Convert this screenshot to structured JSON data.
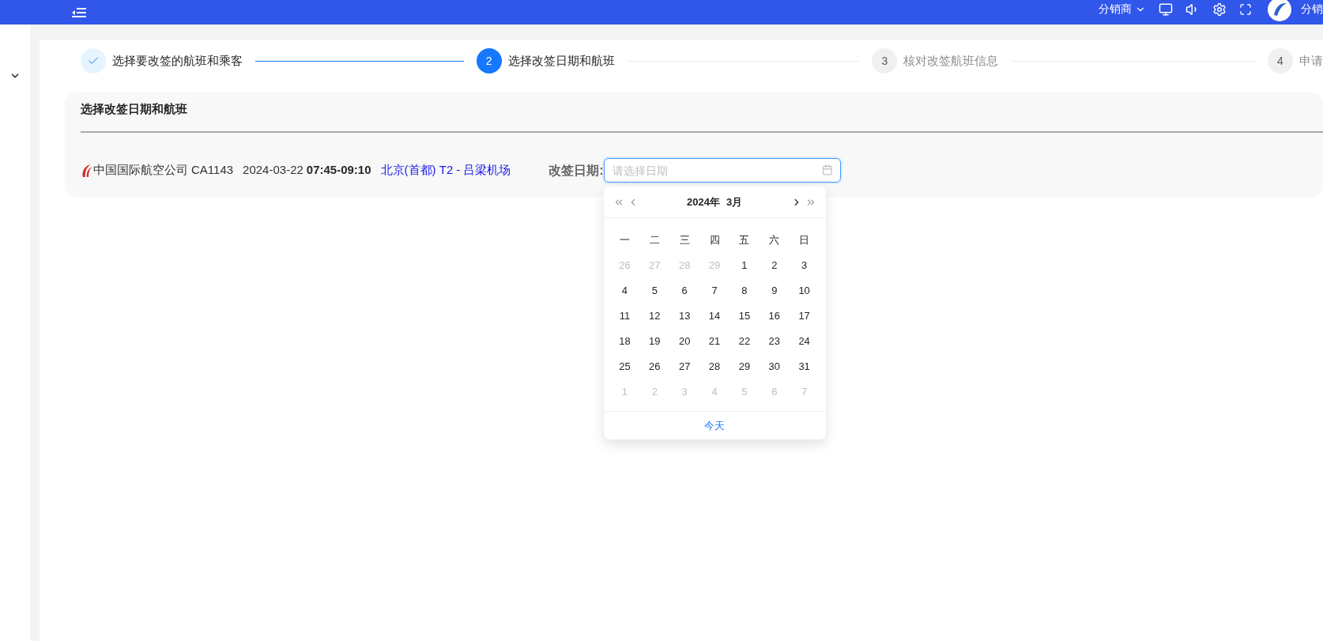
{
  "header": {
    "role_menu": "分销商",
    "user_name": "分销"
  },
  "steps": [
    {
      "label": "选择要改签的航班和乘客",
      "kind": "finish"
    },
    {
      "number": "2",
      "label": "选择改签日期和航班",
      "kind": "process"
    },
    {
      "number": "3",
      "label": "核对改签航班信息",
      "kind": "wait"
    },
    {
      "number": "4",
      "label": "申请",
      "kind": "wait"
    }
  ],
  "section": {
    "title": "选择改签日期和航班",
    "flight": {
      "airline": "中国国际航空公司",
      "flight_no": "CA1143",
      "date": "2024-03-22",
      "time": "07:45-09:10",
      "from": "北京(首都) T2",
      "separator": "-",
      "to": "吕梁机场"
    },
    "date_field": {
      "label": "改签日期:",
      "placeholder": "请选择日期"
    }
  },
  "calendar": {
    "year": "2024年",
    "month": "3月",
    "weekdays": [
      "一",
      "二",
      "三",
      "四",
      "五",
      "六",
      "日"
    ],
    "days": [
      {
        "text": "26",
        "dim": true
      },
      {
        "text": "27",
        "dim": true
      },
      {
        "text": "28",
        "dim": true
      },
      {
        "text": "29",
        "dim": true
      },
      {
        "text": "1",
        "dim": false
      },
      {
        "text": "2",
        "dim": false
      },
      {
        "text": "3",
        "dim": false
      },
      {
        "text": "4",
        "dim": false
      },
      {
        "text": "5",
        "dim": false
      },
      {
        "text": "6",
        "dim": false
      },
      {
        "text": "7",
        "dim": false
      },
      {
        "text": "8",
        "dim": false
      },
      {
        "text": "9",
        "dim": false
      },
      {
        "text": "10",
        "dim": false
      },
      {
        "text": "11",
        "dim": false
      },
      {
        "text": "12",
        "dim": false
      },
      {
        "text": "13",
        "dim": false
      },
      {
        "text": "14",
        "dim": false
      },
      {
        "text": "15",
        "dim": false
      },
      {
        "text": "16",
        "dim": false
      },
      {
        "text": "17",
        "dim": false
      },
      {
        "text": "18",
        "dim": false
      },
      {
        "text": "19",
        "dim": false
      },
      {
        "text": "20",
        "dim": false
      },
      {
        "text": "21",
        "dim": false
      },
      {
        "text": "22",
        "dim": false
      },
      {
        "text": "23",
        "dim": false
      },
      {
        "text": "24",
        "dim": false
      },
      {
        "text": "25",
        "dim": false
      },
      {
        "text": "26",
        "dim": false
      },
      {
        "text": "27",
        "dim": false
      },
      {
        "text": "28",
        "dim": false
      },
      {
        "text": "29",
        "dim": false
      },
      {
        "text": "30",
        "dim": false
      },
      {
        "text": "31",
        "dim": false
      },
      {
        "text": "1",
        "dim": true
      },
      {
        "text": "2",
        "dim": true
      },
      {
        "text": "3",
        "dim": true
      },
      {
        "text": "4",
        "dim": true
      },
      {
        "text": "5",
        "dim": true
      },
      {
        "text": "6",
        "dim": true
      },
      {
        "text": "7",
        "dim": true
      }
    ],
    "today": "今天"
  }
}
